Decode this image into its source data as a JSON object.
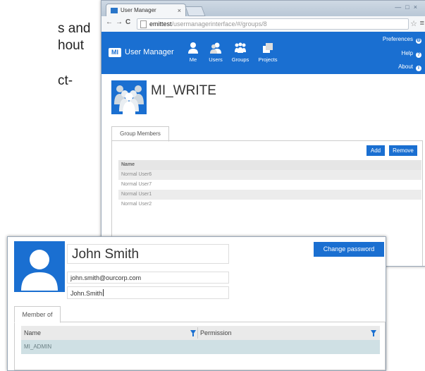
{
  "background_text": [
    "s and",
    "hout",
    "ct-"
  ],
  "browser": {
    "tab_title": "User Manager",
    "tab_close": "×",
    "url_host": "emittest",
    "url_path": "/usermanagerinterface/#/groups/8"
  },
  "app": {
    "logo": "MI",
    "name": "User Manager",
    "nav": [
      {
        "label": "Me",
        "icon": "person-icon"
      },
      {
        "label": "Users",
        "icon": "users-icon"
      },
      {
        "label": "Groups",
        "icon": "groups-icon"
      },
      {
        "label": "Projects",
        "icon": "projects-icon"
      }
    ],
    "right_links": [
      {
        "label": "Preferences",
        "icon": "gear-icon"
      },
      {
        "label": "Help",
        "icon": "help-icon"
      },
      {
        "label": "About",
        "icon": "info-icon"
      }
    ]
  },
  "group": {
    "name": "MI_WRITE",
    "tab": "Group Members",
    "add_label": "Add",
    "remove_label": "Remove",
    "column": "Name",
    "members": [
      "Normal User6",
      "Normal User7",
      "Normal User1",
      "Normal User2"
    ]
  },
  "user": {
    "name": "John Smith",
    "email": "john.smith@ourcorp.com",
    "login": "John.Smith",
    "change_password_label": "Change password",
    "tab": "Member of",
    "columns": [
      "Name",
      "Permission"
    ],
    "rows": [
      {
        "name": "MI_ADMIN",
        "permission": ""
      }
    ]
  },
  "colors": {
    "accent": "#1a6fd1",
    "selected_row": "#cfe0e4"
  }
}
